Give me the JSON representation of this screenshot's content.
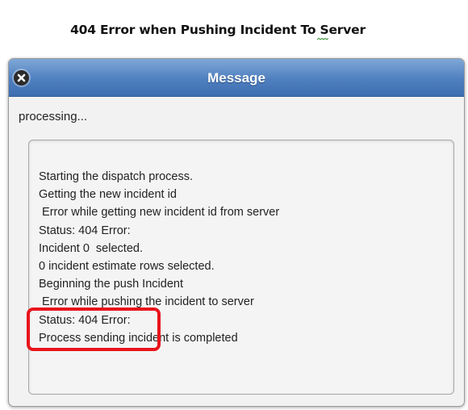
{
  "document": {
    "title": "404 Error when Pushing Incident To Server"
  },
  "dialog": {
    "title": "Message",
    "close_icon": "close-icon",
    "header_color": "#4f7fbf",
    "status": "processing...",
    "log_lines": [
      "Starting the dispatch process.",
      "Getting the new incident id",
      " Error while getting new incident id from server",
      "Status: 404 Error:",
      "Incident 0  selected.",
      "0 incident estimate rows selected.",
      "Beginning the push Incident",
      " Error while pushing the incident to server",
      "Status: 404 Error:",
      "Process sending incident is completed"
    ]
  },
  "annotation": {
    "color": "#e8141b"
  }
}
